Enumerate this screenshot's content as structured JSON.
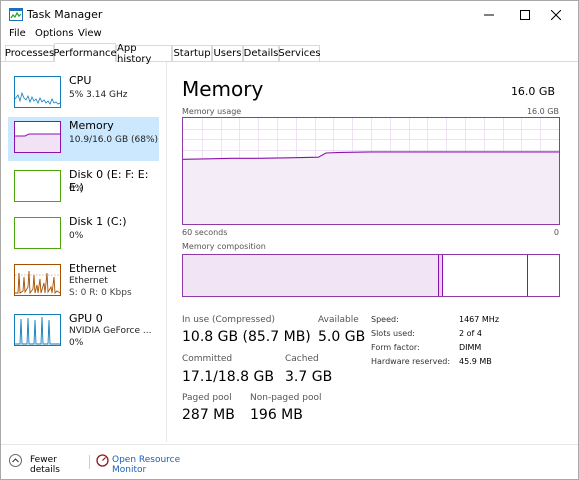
{
  "window": {
    "title": "Task Manager"
  },
  "menu": [
    "File",
    "Options",
    "View"
  ],
  "tabs": [
    "Processes",
    "Performance",
    "App history",
    "Startup",
    "Users",
    "Details",
    "Services"
  ],
  "sidebar": {
    "items": [
      {
        "name": "CPU",
        "sub1": "5%  3.14 GHz",
        "sub2": "",
        "color": "#117dbb",
        "icon": "cpu-graph"
      },
      {
        "name": "Memory",
        "sub1": "10.9/16.0 GB (68%)",
        "sub2": "",
        "color": "#8b12ae",
        "icon": "memory-graph"
      },
      {
        "name": "Disk 0 (E: F: E: E:)",
        "sub1": "0%",
        "sub2": "",
        "color": "#4da60c",
        "icon": "disk-graph"
      },
      {
        "name": "Disk 1 (C:)",
        "sub1": "0%",
        "sub2": "",
        "color": "#4da60c",
        "icon": "disk-graph"
      },
      {
        "name": "Ethernet",
        "sub1": "Ethernet",
        "sub2": "S: 0  R: 0 Kbps",
        "color": "#a74f01",
        "icon": "network-graph"
      },
      {
        "name": "GPU 0",
        "sub1": "NVIDIA GeForce ...",
        "sub2": "0%",
        "color": "#117dbb",
        "icon": "gpu-graph"
      }
    ]
  },
  "main": {
    "title": "Memory",
    "total": "16.0 GB",
    "usage_label": "Memory usage",
    "usage_max": "16.0 GB",
    "time_label": "60 seconds",
    "time_zero": "0",
    "composition_label": "Memory composition",
    "usage_fraction": 0.68,
    "colors": {
      "accent": "#8b12ae",
      "grid": "#e9d6ef",
      "fill": "#f4ecf7"
    }
  },
  "stats": {
    "in_use_label": "In use (Compressed)",
    "in_use_value": "10.8 GB (85.7 MB)",
    "available_label": "Available",
    "available_value": "5.0 GB",
    "committed_label": "Committed",
    "committed_value": "17.1/18.8 GB",
    "cached_label": "Cached",
    "cached_value": "3.7 GB",
    "paged_label": "Paged pool",
    "paged_value": "287 MB",
    "nonpaged_label": "Non-paged pool",
    "nonpaged_value": "196 MB"
  },
  "specs": [
    {
      "label": "Speed:",
      "value": "1467 MHz"
    },
    {
      "label": "Slots used:",
      "value": "2 of 4"
    },
    {
      "label": "Form factor:",
      "value": "DIMM"
    },
    {
      "label": "Hardware reserved:",
      "value": "45.9 MB"
    }
  ],
  "footer": {
    "fewer_details": "Fewer details",
    "open_monitor": "Open Resource Monitor"
  }
}
